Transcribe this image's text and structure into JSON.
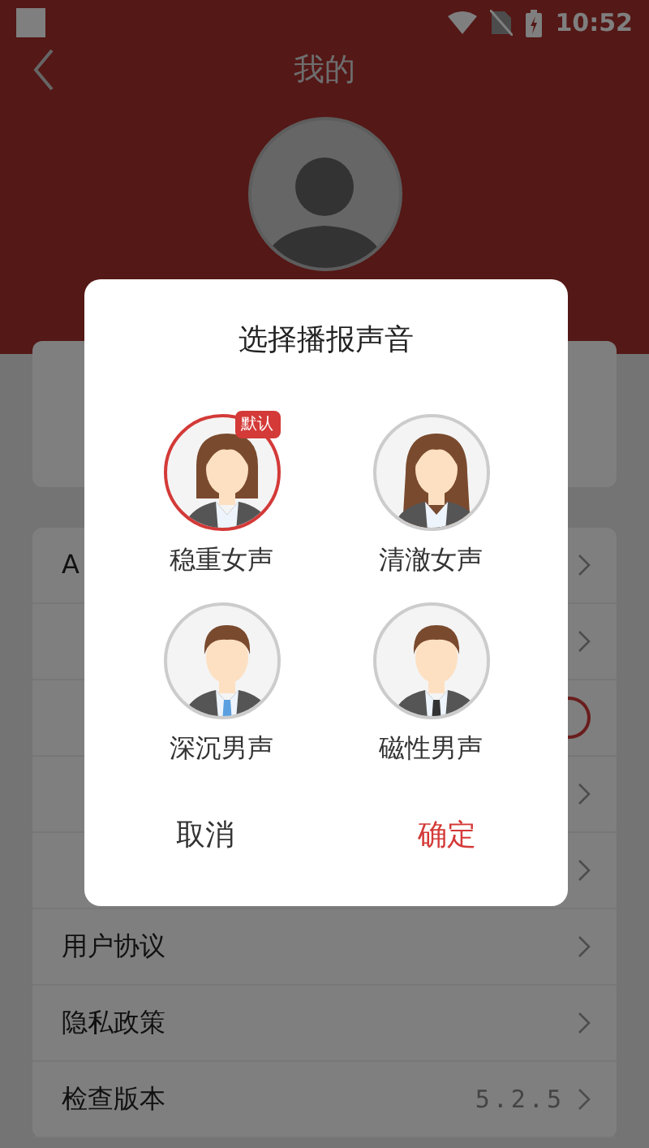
{
  "status_bar": {
    "time": "10:52"
  },
  "header": {
    "title": "我的"
  },
  "settings": [
    {
      "kind": "chevron",
      "label": "A"
    },
    {
      "kind": "chevron"
    },
    {
      "kind": "toggle",
      "on": true
    },
    {
      "kind": "chevron"
    },
    {
      "kind": "chevron"
    },
    {
      "kind": "chevron",
      "label": "用户协议"
    },
    {
      "kind": "chevron",
      "label": "隐私政策"
    },
    {
      "kind": "chevron",
      "label": "检查版本",
      "value": "5.2.5"
    }
  ],
  "dialog": {
    "title": "选择播报声音",
    "voices": [
      {
        "label": "稳重女声",
        "kind": "female_short",
        "selected": true,
        "badge": "默认"
      },
      {
        "label": "清澈女声",
        "kind": "female_long",
        "selected": false
      },
      {
        "label": "深沉男声",
        "kind": "male_light_tie",
        "selected": false
      },
      {
        "label": "磁性男声",
        "kind": "male_dark_tie",
        "selected": false
      }
    ],
    "buttons": [
      {
        "label": "取消",
        "kind": "cancel"
      },
      {
        "label": "确定",
        "kind": "confirm"
      }
    ]
  }
}
